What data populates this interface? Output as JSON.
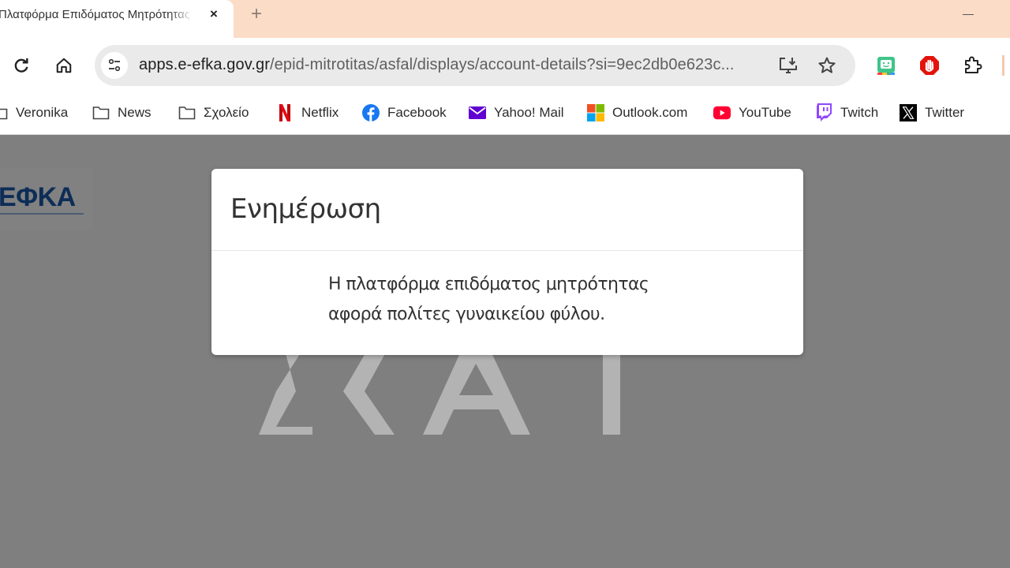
{
  "browser": {
    "tab": {
      "title": "Πλατφόρμα Επιδόματος Μητρότητας",
      "close_icon": "×"
    },
    "new_tab_icon": "+",
    "omnibox": {
      "url_host": "apps.e-efka.gov.gr",
      "url_path": "/epid-mitrotitas/asfal/displays/account-details?si=9ec2db0e623c..."
    },
    "colors": {
      "tabstrip": "#fbdcc7"
    }
  },
  "bookmarks": [
    {
      "label": "Veronika",
      "icon": "folder-icon"
    },
    {
      "label": "News",
      "icon": "folder-icon"
    },
    {
      "label": "Σχολείο",
      "icon": "folder-icon"
    },
    {
      "label": "Netflix",
      "icon": "netflix-icon"
    },
    {
      "label": "Facebook",
      "icon": "facebook-icon"
    },
    {
      "label": "Yahoo! Mail",
      "icon": "yahoo-mail-icon"
    },
    {
      "label": "Outlook.com",
      "icon": "microsoft-icon"
    },
    {
      "label": "YouTube",
      "icon": "youtube-icon"
    },
    {
      "label": "Twitch",
      "icon": "twitch-icon"
    },
    {
      "label": "Twitter",
      "icon": "x-icon"
    }
  ],
  "page": {
    "logo_text": "ΕΦΚΑ",
    "watermark": "ΣΚΑΪ",
    "modal": {
      "title": "Ενημέρωση",
      "body_line1": "Η πλατφόρμα επιδόματος μητρότητας",
      "body_line2": "αφορά πολίτες γυναικείου φύλου."
    }
  }
}
